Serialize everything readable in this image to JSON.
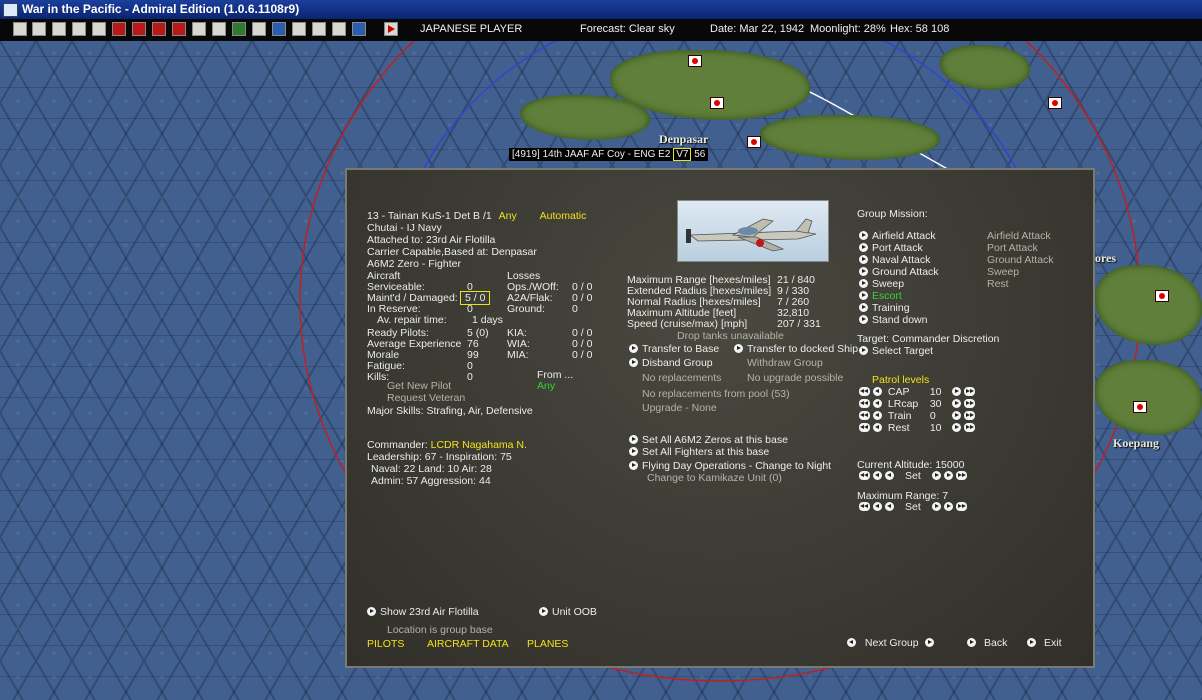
{
  "window": {
    "title": "War in the Pacific - Admiral Edition (1.0.6.1108r9)"
  },
  "toolbar": {
    "player": "JAPANESE PLAYER",
    "forecast": "Forecast: Clear sky",
    "date": "Date: Mar 22, 1942",
    "moonlight": "Moonlight: 28%",
    "hex": "Hex: 58 108"
  },
  "map": {
    "places": [
      "Denpasar",
      "Koepang",
      "ores"
    ],
    "hex_tooltip": {
      "text": "[4919] 14th JAAF AF Coy  - ENG  E2",
      "boxed": "V7",
      "suffix": "56"
    }
  },
  "group": {
    "name": "13 - Tainan KuS-1 Det B /1",
    "any": "Any",
    "automatic": "Automatic",
    "unit": "Chutai - IJ Navy",
    "attached": "Attached to: 23rd Air Flotilla",
    "carrier": "Carrier Capable,Based at:  Denpasar",
    "aircraft_type": "A6M2 Zero - Fighter"
  },
  "aircraft": {
    "header": "Aircraft",
    "rows": [
      {
        "label": "Serviceable:",
        "value": "0"
      },
      {
        "label": "Maint'd / Damaged:",
        "value": "5 / 0"
      },
      {
        "label": "In Reserve:",
        "value": "0"
      }
    ],
    "repair_label": "Av. repair time:",
    "repair_value": "1 days"
  },
  "losses": {
    "header": "Losses",
    "rows": [
      {
        "label": "Ops./WOff:",
        "value": "0 / 0"
      },
      {
        "label": "A2A/Flak:",
        "value": "0 / 0"
      },
      {
        "label": "Ground:",
        "value": "0"
      }
    ]
  },
  "pilots": {
    "rows": [
      {
        "label": "Ready Pilots:",
        "value": "5 (0)"
      },
      {
        "label": "Average Experience",
        "value": "76"
      },
      {
        "label": "Morale",
        "value": "99"
      },
      {
        "label": "Fatigue:",
        "value": "0"
      },
      {
        "label": "Kills:",
        "value": "0"
      }
    ],
    "casualties": [
      {
        "label": "KIA:",
        "value": "0 / 0"
      },
      {
        "label": "WIA:",
        "value": "0 / 0"
      },
      {
        "label": "MIA:",
        "value": "0 / 0"
      }
    ],
    "from_label": "From ...",
    "from_value": "Any",
    "get_new_pilot": "Get New Pilot",
    "request_veteran": "Request Veteran",
    "major_skills": "Major Skills: Strafing, Air, Defensive"
  },
  "commander": {
    "label": "Commander:",
    "name": "LCDR Nagahama N.",
    "line1": "Leadership: 67 - Inspiration: 75",
    "line2": "Naval: 22  Land: 10  Air: 28",
    "line3": "Admin: 57  Aggression: 44"
  },
  "performance": {
    "rows": [
      {
        "label": "Maximum Range [hexes/miles]",
        "value": "21 / 840"
      },
      {
        "label": "Extended Radius [hexes/miles]",
        "value": "9 / 330"
      },
      {
        "label": "Normal Radius [hexes/miles]",
        "value": "7 / 260"
      },
      {
        "label": "Maximum Altitude [feet]",
        "value": "32,810"
      },
      {
        "label": "Speed (cruise/max) [mph]",
        "value": "207 / 331"
      }
    ],
    "drop_tanks": "Drop tanks unavailable"
  },
  "actions": {
    "transfer_base": "Transfer to Base",
    "transfer_ship": "Transfer to docked Ship",
    "disband": "Disband Group",
    "withdraw": "Withdraw Group",
    "no_replacements": "No replacements",
    "no_upgrade": "No upgrade possible",
    "no_pool": "No replacements from pool (53)",
    "upgrade_none": "Upgrade - None",
    "set_all_zeros": "Set All A6M2 Zeros at this base",
    "set_all_fighters": "Set All Fighters at this base",
    "flying_day": "Flying Day Operations - Change to Night",
    "kamikaze": "Change to Kamikaze Unit (0)"
  },
  "mission": {
    "header": "Group Mission:",
    "options": [
      "Airfield Attack",
      "Port Attack",
      "Naval Attack",
      "Ground Attack",
      "Sweep",
      "Escort",
      "Training",
      "Stand down"
    ],
    "secondary": [
      "Airfield Attack",
      "Port Attack",
      "Ground Attack",
      "Sweep",
      "Rest"
    ],
    "target": "Target: Commander Discretion",
    "select_target": "Select Target"
  },
  "patrol": {
    "header": "Patrol levels",
    "rows": [
      {
        "label": "CAP",
        "value": "10"
      },
      {
        "label": "LRcap",
        "value": "30"
      },
      {
        "label": "Train",
        "value": "0"
      },
      {
        "label": "Rest",
        "value": "10"
      }
    ]
  },
  "altitude": {
    "label": "Current Altitude: 15000",
    "set": "Set"
  },
  "range": {
    "label": "Maximum Range: 7",
    "set": "Set"
  },
  "bottom": {
    "show_flotilla": "Show 23rd Air Flotilla",
    "unit_oob": "Unit OOB",
    "location": "Location is group base",
    "tabs": [
      "PILOTS",
      "AIRCRAFT DATA",
      "PLANES"
    ],
    "next_group": "Next Group",
    "back": "Back",
    "exit": "Exit"
  }
}
